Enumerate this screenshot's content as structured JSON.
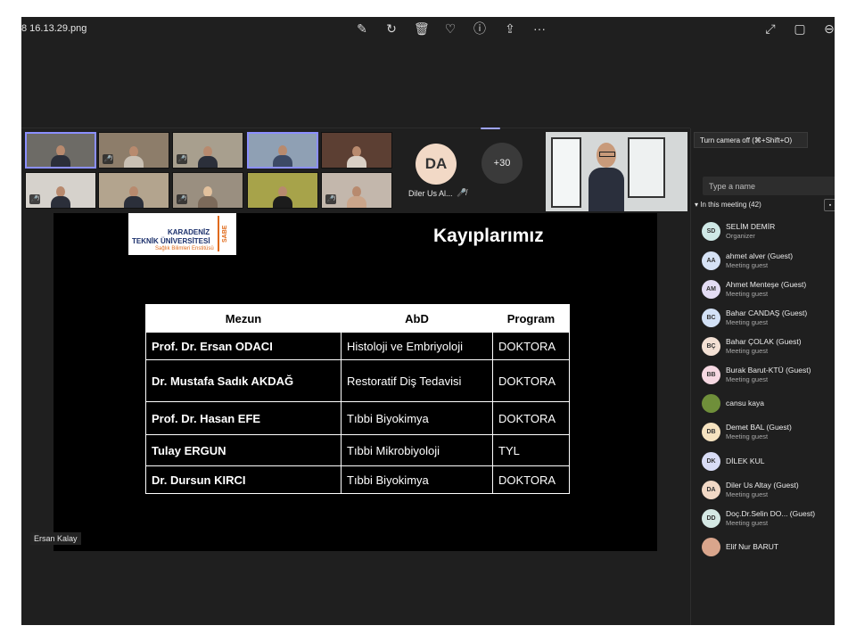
{
  "topbar": {
    "filename": "8 16.13.29.png",
    "icons": [
      "edit-icon",
      "rotate-icon",
      "trash-icon",
      "heart-icon",
      "info-icon",
      "share-icon",
      "more-icon",
      "expand-icon",
      "fit-icon",
      "zoom-icon"
    ]
  },
  "gallery": {
    "mic_glyph": "🎤̸",
    "da_initials": "DA",
    "da_name": "Diler Us Al...",
    "more_count": "+30"
  },
  "slide": {
    "logo_line1": "KARADENİZ",
    "logo_line2": "TEKNİK ÜNİVERSİTESİ",
    "logo_line3": "Sağlık Bilimleri Enstitüsü",
    "logo_side": "SABE",
    "title": "Kayıplarımız",
    "columns": [
      "Mezun",
      "AbD",
      "Program"
    ],
    "rows": [
      {
        "name": "Prof. Dr. Ersan ODACI",
        "dept": "Histoloji ve Embriyoloji",
        "program": "DOKTORA"
      },
      {
        "name": "Dr. Mustafa Sadık AKDAĞ",
        "dept": "Restoratif Diş Tedavisi",
        "program": "DOKTORA"
      },
      {
        "name": "Prof. Dr. Hasan EFE",
        "dept": "Tıbbi Biyokimya",
        "program": "DOKTORA"
      },
      {
        "name": "Tulay ERGUN",
        "dept": "Tıbbi Mikrobiyoloji",
        "program": "TYL"
      },
      {
        "name": "Dr. Dursun KIRCI",
        "dept": "Tıbbi Biyokimya",
        "program": "DOKTORA"
      }
    ]
  },
  "speaker_label": "Ersan Kalay",
  "panel": {
    "tooltip": "Turn camera off (⌘+Shift+O)",
    "search_placeholder": "Type a name",
    "in_meeting": "In this meeting (42)",
    "participants": [
      {
        "initials": "SD",
        "name": "SELİM DEMİR",
        "role": "Organizer",
        "color": "#cfe8e6"
      },
      {
        "initials": "AA",
        "name": "ahmet alver (Guest)",
        "role": "Meeting guest",
        "color": "#d6e2f5"
      },
      {
        "initials": "AM",
        "name": "Ahmet Menteşe (Guest)",
        "role": "Meeting guest",
        "color": "#e3dcf3"
      },
      {
        "initials": "BC",
        "name": "Bahar CANDAŞ (Guest)",
        "role": "Meeting guest",
        "color": "#d3e1f6"
      },
      {
        "initials": "BÇ",
        "name": "Bahar ÇOLAK (Guest)",
        "role": "Meeting guest",
        "color": "#f3e0d4"
      },
      {
        "initials": "BB",
        "name": "Burak Barut-KTÜ (Guest)",
        "role": "Meeting guest",
        "color": "#f6d8e2"
      },
      {
        "initials": "",
        "name": "cansu kaya",
        "role": "",
        "color": "#6f8f3a"
      },
      {
        "initials": "DB",
        "name": "Demet BAL (Guest)",
        "role": "Meeting guest",
        "color": "#f6e3c0"
      },
      {
        "initials": "DK",
        "name": "DİLEK KUL",
        "role": "",
        "color": "#d8dcf5"
      },
      {
        "initials": "DA",
        "name": "Diler Us Altay (Guest)",
        "role": "Meeting guest",
        "color": "#f2d9c6"
      },
      {
        "initials": "DD",
        "name": "Doç.Dr.Selin DO... (Guest)",
        "role": "Meeting guest",
        "color": "#d4e8e4"
      },
      {
        "initials": "",
        "name": "Elif Nur BARUT",
        "role": "",
        "color": "#d9a58c"
      }
    ]
  }
}
